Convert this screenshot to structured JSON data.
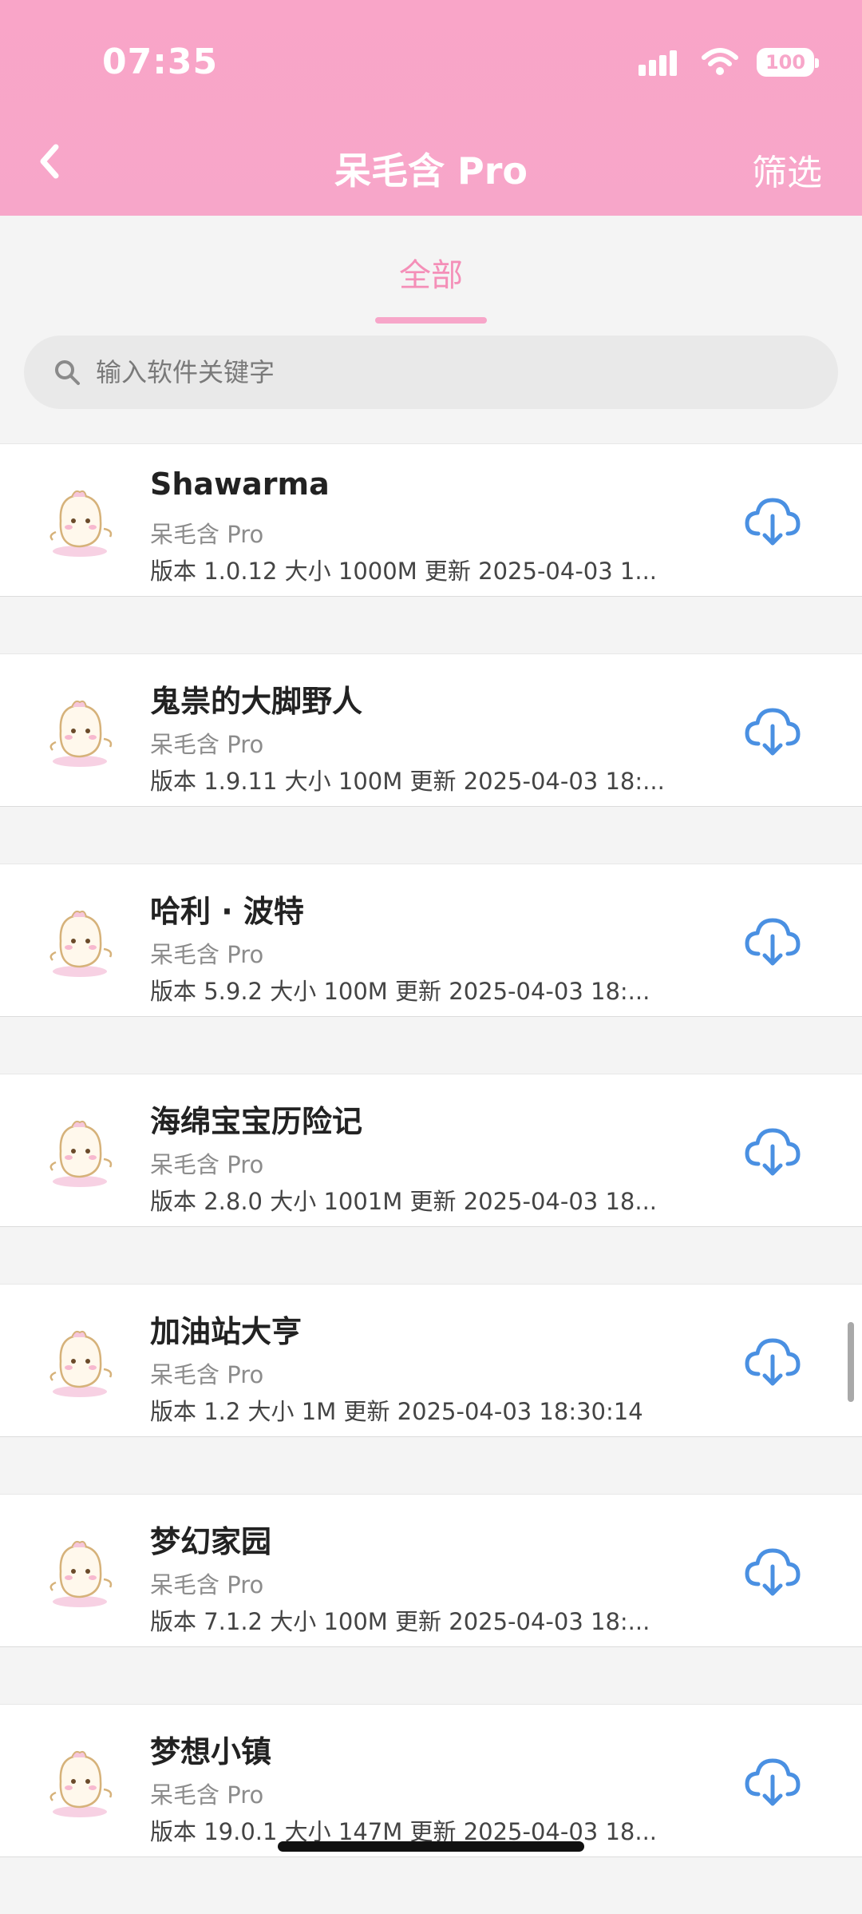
{
  "status": {
    "time": "07:35",
    "battery": "100"
  },
  "nav": {
    "title": "呆毛含 Pro",
    "filter": "筛选"
  },
  "tabs": [
    {
      "label": "全部",
      "active": true
    }
  ],
  "search": {
    "placeholder": "输入软件关键字"
  },
  "apps": [
    {
      "name": "Shawarma",
      "developer": "呆毛含 Pro",
      "meta": "版本 1.0.12  大小 1000M  更新 2025-04-03 1..."
    },
    {
      "name": "鬼祟的大脚野人",
      "developer": "呆毛含 Pro",
      "meta": "版本 1.9.11  大小 100M  更新 2025-04-03 18:..."
    },
    {
      "name": "哈利 · 波特",
      "developer": "呆毛含 Pro",
      "meta": "版本 5.9.2  大小 100M  更新 2025-04-03 18:..."
    },
    {
      "name": "海绵宝宝历险记",
      "developer": "呆毛含 Pro",
      "meta": "版本 2.8.0  大小 1001M  更新 2025-04-03 18..."
    },
    {
      "name": "加油站大亨",
      "developer": "呆毛含 Pro",
      "meta": "版本 1.2  大小 1M  更新 2025-04-03 18:30:14"
    },
    {
      "name": "梦幻家园",
      "developer": "呆毛含 Pro",
      "meta": "版本 7.1.2  大小 100M  更新 2025-04-03 18:..."
    },
    {
      "name": "梦想小镇",
      "developer": "呆毛含 Pro",
      "meta": "版本 19.0.1  大小 147M  更新 2025-04-03 18..."
    }
  ],
  "colors": {
    "header": "#f7a6c9",
    "accent": "#f48fb8",
    "download": "#4a90e2"
  },
  "icons": {
    "download": "cloud-download-icon",
    "search": "search-icon",
    "back": "chevron-left-icon"
  }
}
